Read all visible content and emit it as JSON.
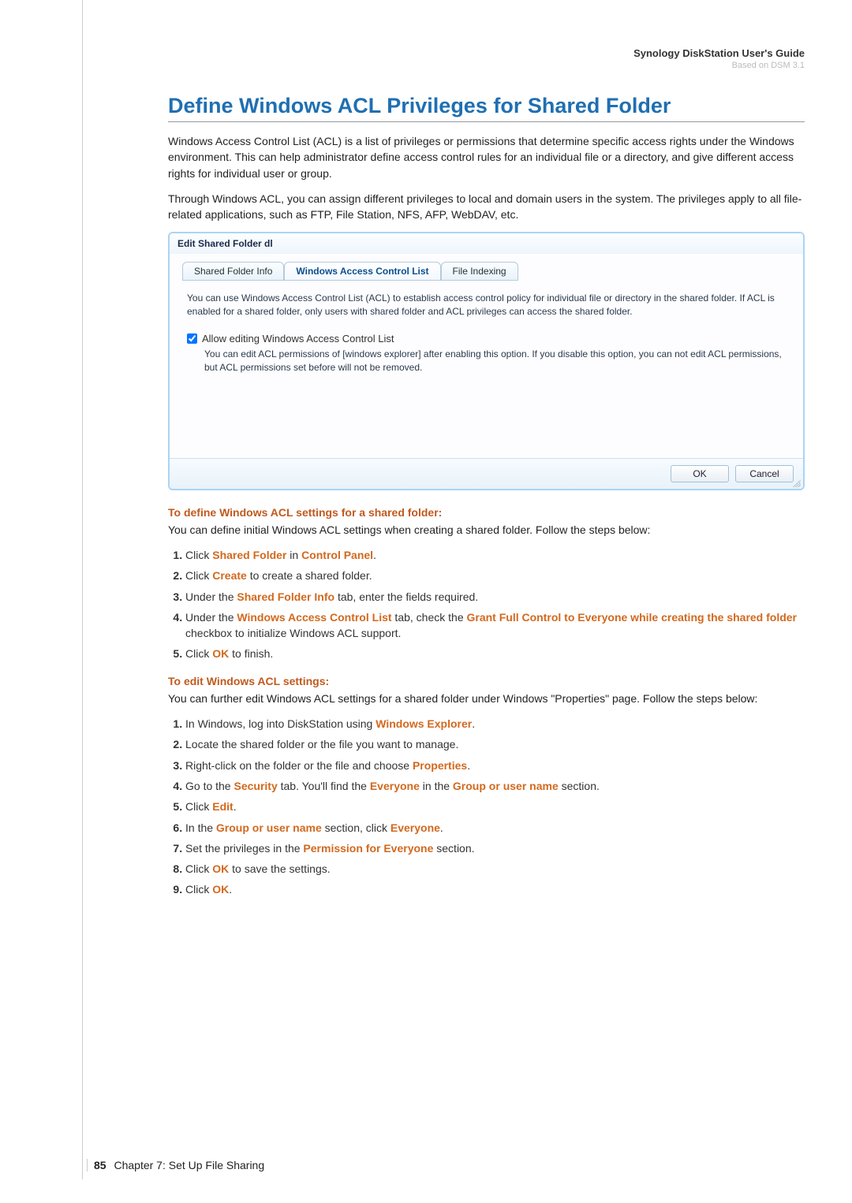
{
  "header": {
    "doc_title": "Synology DiskStation User's Guide",
    "doc_sub": "Based on DSM 3.1"
  },
  "h1": "Define Windows ACL Privileges for Shared Folder",
  "para1": "Windows Access Control List (ACL) is a list of privileges or permissions that determine specific access rights under the Windows environment. This can help administrator define access control rules for an individual file or a directory, and give different access rights for individual user or group.",
  "para2": "Through Windows ACL, you can assign different privileges to local and domain users in the system. The privileges apply to all file-related applications, such as FTP, File Station, NFS, AFP, WebDAV, etc.",
  "dialog": {
    "title": "Edit Shared Folder dl",
    "tabs": [
      "Shared Folder Info",
      "Windows Access Control List",
      "File Indexing"
    ],
    "active_tab": 1,
    "desc": "You can use Windows Access Control List (ACL) to establish access control policy for individual file or directory in the shared folder. If ACL is enabled for a shared folder, only users with shared folder and ACL privileges can access the shared folder.",
    "checkbox_label": "Allow editing Windows Access Control List",
    "checkbox_checked": true,
    "checkbox_note": "You can edit ACL permissions of [windows explorer] after enabling this option. If you disable this option, you can not edit ACL permissions, but ACL permissions set before will not be removed.",
    "btn_ok": "OK",
    "btn_cancel": "Cancel"
  },
  "section_define": {
    "title": "To define Windows ACL settings for a shared folder:",
    "intro": "You can define initial Windows ACL settings when creating a shared folder. Follow the steps below:",
    "steps": [
      {
        "pre": "Click ",
        "a1": "Shared Folder",
        "mid": " in ",
        "a2": "Control Panel",
        "post": "."
      },
      {
        "pre": "Click ",
        "a1": "Create",
        "post": " to create a shared folder."
      },
      {
        "pre": "Under the ",
        "a1": "Shared Folder Info",
        "post": " tab, enter the fields required."
      },
      {
        "pre": "Under the ",
        "a1": "Windows Access Control List",
        "mid": " tab, check the ",
        "a2": "Grant Full Control to Everyone while creating the shared folder",
        "post": " checkbox to initialize Windows ACL support."
      },
      {
        "pre": "Click ",
        "a1": "OK",
        "post": " to finish."
      }
    ]
  },
  "section_edit": {
    "title": "To edit Windows ACL settings:",
    "intro": "You can further edit Windows ACL settings for a shared folder under Windows \"Properties\" page. Follow the steps below:",
    "steps": [
      {
        "pre": "In Windows, log into DiskStation using ",
        "a1": "Windows Explorer",
        "post": "."
      },
      {
        "pre": "Locate the shared folder or the file you want to manage."
      },
      {
        "pre": "Right-click on the folder or the file and choose ",
        "a1": "Properties",
        "post": "."
      },
      {
        "pre": "Go to the ",
        "a1": "Security",
        "mid": " tab. You'll find the ",
        "a2": "Everyone",
        "mid2": " in the ",
        "a3": "Group or user name",
        "post": " section."
      },
      {
        "pre": "Click ",
        "a1": "Edit",
        "post": "."
      },
      {
        "pre": "In the ",
        "a1": "Group or user name",
        "mid": " section, click ",
        "a2": "Everyone",
        "post": "."
      },
      {
        "pre": "Set the privileges in the ",
        "a1": "Permission for Everyone",
        "post": " section."
      },
      {
        "pre": "Click ",
        "a1": "OK",
        "post": " to save the settings."
      },
      {
        "pre": "Click ",
        "a1": "OK",
        "post": "."
      }
    ]
  },
  "footer": {
    "page": "85",
    "chapter": "Chapter 7: Set Up File Sharing"
  }
}
